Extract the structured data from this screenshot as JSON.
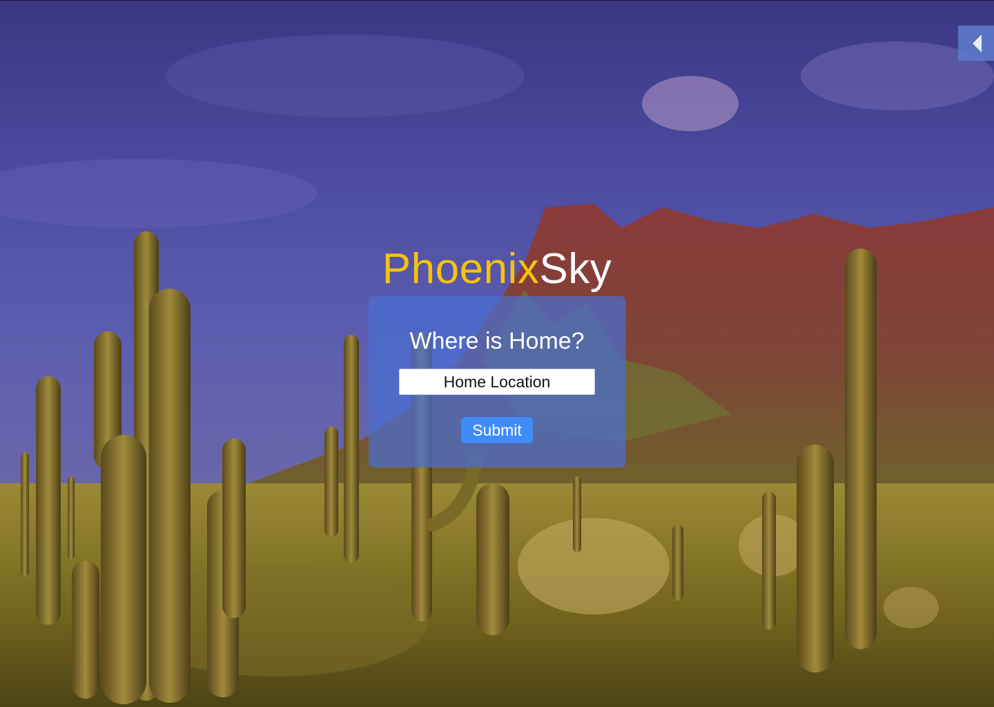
{
  "brand": {
    "part1": "Phoenix",
    "part2": "Sky",
    "part1_color": "#f6c20e",
    "part2_color": "#ffffff"
  },
  "panel": {
    "heading": "Where is Home?",
    "location_placeholder": "Home Location",
    "location_value": "",
    "submit_label": "Submit"
  },
  "background": {
    "description_icon": "desert-landscape-image"
  },
  "collapse_tab": {
    "icon": "caret-left-icon"
  },
  "colors": {
    "panel": "#4a6ed2",
    "button": "#3f8cf6",
    "tab": "#5e7bcd"
  }
}
